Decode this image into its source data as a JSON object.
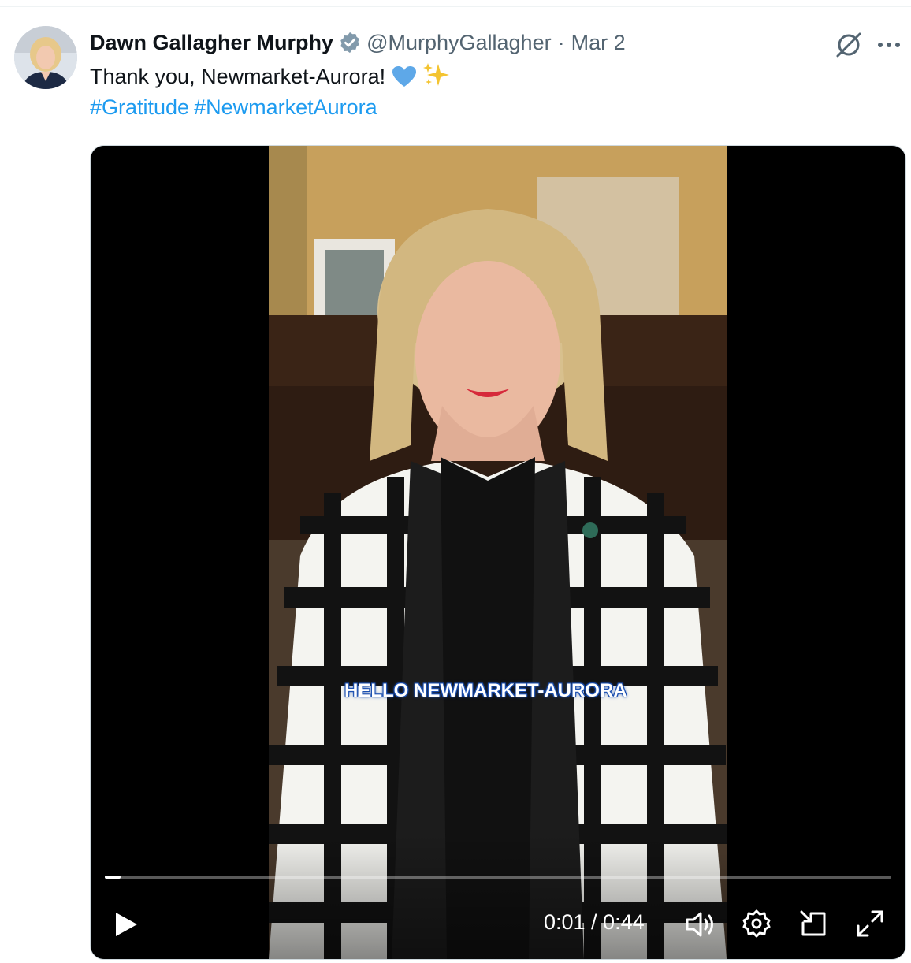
{
  "tweet": {
    "author_name": "Dawn Gallagher Murphy",
    "handle": "@MurphyGallagher",
    "separator": "·",
    "date": "Mar 2",
    "text": "Thank you, Newmarket-Aurora!",
    "emojis": [
      "blue-heart-emoji",
      "sparkles-emoji"
    ],
    "hashtags": [
      "#Gratitude",
      "#NewmarketAurora"
    ]
  },
  "icons": {
    "verified": "verified-badge-icon",
    "grok": "grok-icon",
    "more": "more-icon"
  },
  "video": {
    "caption": "HELLO NEWMARKET-AURORA",
    "current_time": "0:01",
    "duration": "0:44",
    "time_display": "0:01 / 0:44",
    "progress_fraction": 0.02,
    "controls": [
      "play-icon",
      "volume-icon",
      "settings-icon",
      "pip-icon",
      "fullscreen-icon"
    ]
  },
  "colors": {
    "link": "#1d9bf0",
    "text": "#0f1419",
    "secondary": "#536471",
    "verified": "#829aab"
  }
}
